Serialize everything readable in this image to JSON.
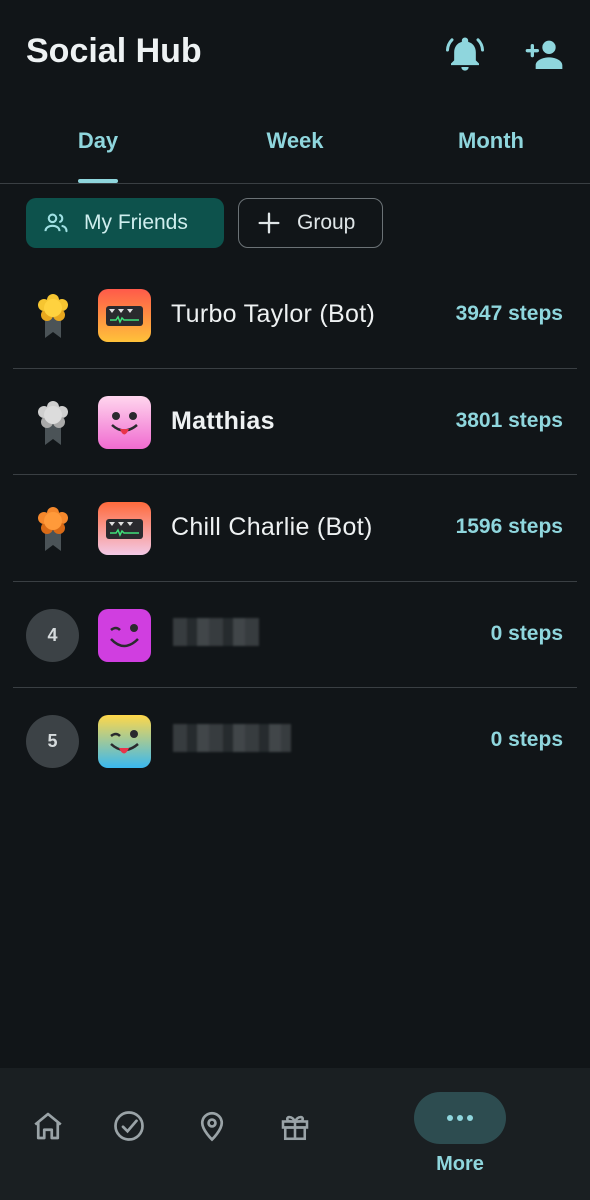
{
  "header": {
    "title": "Social Hub",
    "icons": [
      "bell-icon",
      "add-person-icon"
    ]
  },
  "tabs": [
    {
      "label": "Day",
      "selected": true
    },
    {
      "label": "Week",
      "selected": false
    },
    {
      "label": "Month",
      "selected": false
    }
  ],
  "filters": {
    "friends_label": "My Friends",
    "group_label": "Group"
  },
  "leaderboard": [
    {
      "rank": "1",
      "badge": "gold-medal-icon",
      "name": "Turbo Taylor (Bot)",
      "steps": "3947 steps",
      "bold": false
    },
    {
      "rank": "2",
      "badge": "silver-medal-icon",
      "name": "Matthias",
      "steps": "3801 steps",
      "bold": true
    },
    {
      "rank": "3",
      "badge": "bronze-medal-icon",
      "name": "Chill Charlie (Bot)",
      "steps": "1596 steps",
      "bold": false
    },
    {
      "rank": "4",
      "badge": "",
      "name": "",
      "steps": "0 steps",
      "bold": false
    },
    {
      "rank": "5",
      "badge": "",
      "name": "",
      "steps": "0 steps",
      "bold": false
    }
  ],
  "nav": {
    "items": [
      "home-icon",
      "check-circle-icon",
      "location-pin-icon",
      "gift-icon",
      "more-icon"
    ],
    "more_label": "More"
  },
  "colors": {
    "background": "#111518",
    "accent": "#8fd6dd",
    "chip_selected": "#0d524c",
    "nav_background": "#1a1f22"
  }
}
